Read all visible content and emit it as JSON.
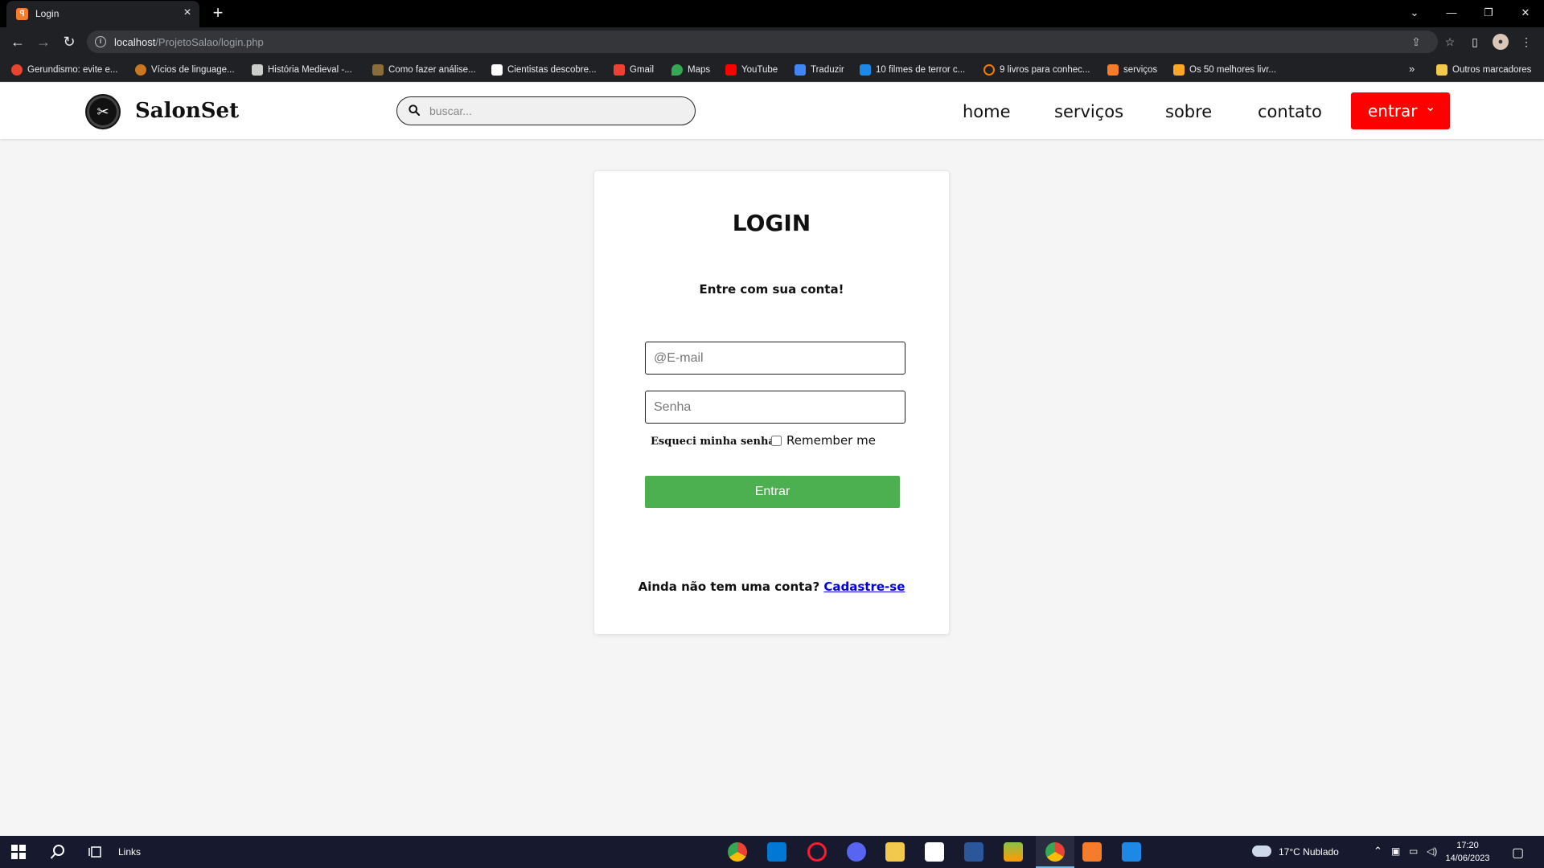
{
  "browser": {
    "tab_title": "Login",
    "url_host": "localhost",
    "url_path": "/ProjetoSalao/login.php",
    "bookmarks": [
      {
        "label": "Gerundismo: evite e...",
        "color": "#e8442e"
      },
      {
        "label": "Vícios de linguage...",
        "color": "#c9781f"
      },
      {
        "label": "História Medieval -...",
        "color": "#cccccc"
      },
      {
        "label": "Como fazer análise...",
        "color": "#8a6d3b"
      },
      {
        "label": "Cientistas descobre...",
        "color": "#ffffff"
      },
      {
        "label": "Gmail",
        "color": "#ea4335"
      },
      {
        "label": "Maps",
        "color": "#34a853"
      },
      {
        "label": "YouTube",
        "color": "#ff0000"
      },
      {
        "label": "Traduzir",
        "color": "#4285f4"
      },
      {
        "label": "10 filmes de terror c...",
        "color": "#1e88e5"
      },
      {
        "label": "9 livros para conhec...",
        "color": "#f57c00"
      },
      {
        "label": "serviços",
        "color": "#f57c2a"
      },
      {
        "label": "Os 50 melhores livr...",
        "color": "#f9a825"
      }
    ],
    "other_bookmarks": "Outros marcadores"
  },
  "site": {
    "brand": "SalonSet",
    "search_placeholder": "buscar...",
    "nav": [
      "home",
      "serviços",
      "sobre",
      "contato"
    ],
    "enter_button": "entrar",
    "accent_color": "#ff0000"
  },
  "login": {
    "title": "LOGIN",
    "subtitle": "Entre com sua conta!",
    "email_placeholder": "@E-mail",
    "password_placeholder": "Senha",
    "forgot": "Esqueci minha senha",
    "remember": "Remember me",
    "submit": "Entrar",
    "signup_prompt": "Ainda não tem uma conta?",
    "signup_link": "Cadastre-se",
    "submit_color": "#4caf50"
  },
  "taskbar": {
    "links_label": "Links",
    "weather": "17°C  Nublado",
    "time": "17:20",
    "date": "14/06/2023"
  }
}
